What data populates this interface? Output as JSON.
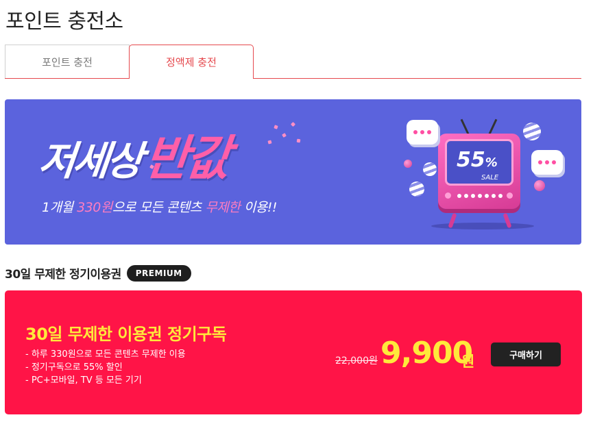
{
  "page": {
    "title": "포인트 충전소"
  },
  "tabs": [
    {
      "label": "포인트 충전",
      "active": false
    },
    {
      "label": "정액제 충전",
      "active": true
    }
  ],
  "banner": {
    "headline_white": "저세상",
    "headline_pink": "반값",
    "sub_prefix": "1개월 ",
    "sub_price": "330원",
    "sub_mid": "으로 모든 콘텐츠 ",
    "sub_hl": "무제한",
    "sub_suffix": " 이용!!",
    "tv_percent": "55",
    "tv_percent_sign": "%",
    "tv_sale": "SALE",
    "colors": {
      "background": "#5b63dd",
      "accent_pink": "#ff5fa8"
    }
  },
  "section": {
    "title": "30일 무제한 정기이용권",
    "badge": "PREMIUM"
  },
  "product": {
    "title": "30일 무제한 이용권 정기구독",
    "bullets": [
      "- 하루 330원으로 모든 콘텐츠 무제한 이용",
      "- 정기구독으로 55% 할인",
      "- PC+모바일, TV 등 모든 기기"
    ],
    "original_price": "22,000원",
    "price": "9,900",
    "price_unit": "원",
    "buy_label": "구매하기",
    "colors": {
      "card": "#ff1447",
      "title": "#ffe93b"
    }
  }
}
